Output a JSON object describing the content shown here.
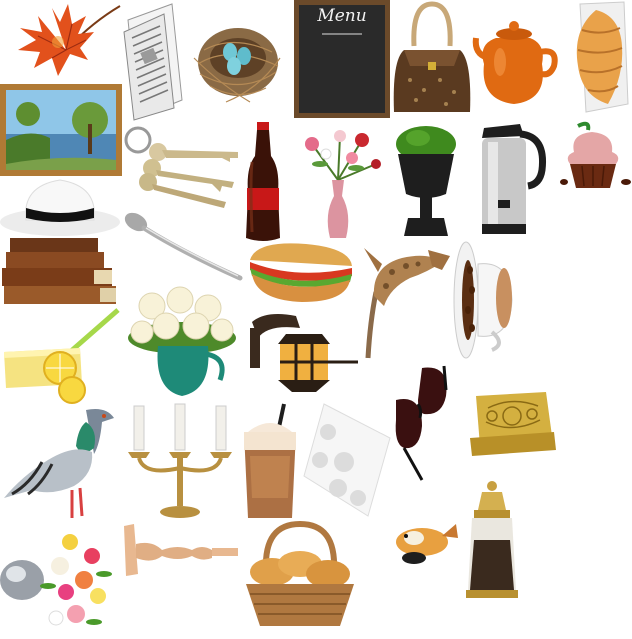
{
  "scene": {
    "background": "#ffffff",
    "objects": [
      {
        "name": "autumn-leaf"
      },
      {
        "name": "newspaper"
      },
      {
        "name": "bird-nest-with-eggs"
      },
      {
        "name": "chalkboard-menu",
        "text": "Menu"
      },
      {
        "name": "leather-handbag"
      },
      {
        "name": "orange-teapot"
      },
      {
        "name": "croissant-on-plate"
      },
      {
        "name": "framed-landscape-painting"
      },
      {
        "name": "keys"
      },
      {
        "name": "cola-bottle"
      },
      {
        "name": "flower-vase"
      },
      {
        "name": "potted-boxwood"
      },
      {
        "name": "thermos-jug"
      },
      {
        "name": "cupcake"
      },
      {
        "name": "white-hat"
      },
      {
        "name": "spoon"
      },
      {
        "name": "old-books"
      },
      {
        "name": "sandwich"
      },
      {
        "name": "leaping-cat"
      },
      {
        "name": "coffee-cup-with-beans"
      },
      {
        "name": "lemonade-glass"
      },
      {
        "name": "roses-in-jug"
      },
      {
        "name": "wall-lantern"
      },
      {
        "name": "sunglasses"
      },
      {
        "name": "gold-napkin-holder"
      },
      {
        "name": "pigeon"
      },
      {
        "name": "candelabra"
      },
      {
        "name": "iced-coffee"
      },
      {
        "name": "lace-napkin"
      },
      {
        "name": "flower-bouquet-lamp"
      },
      {
        "name": "wooden-candlestick"
      },
      {
        "name": "bread-basket"
      },
      {
        "name": "cat-toy"
      },
      {
        "name": "pepper-grinder"
      }
    ]
  }
}
